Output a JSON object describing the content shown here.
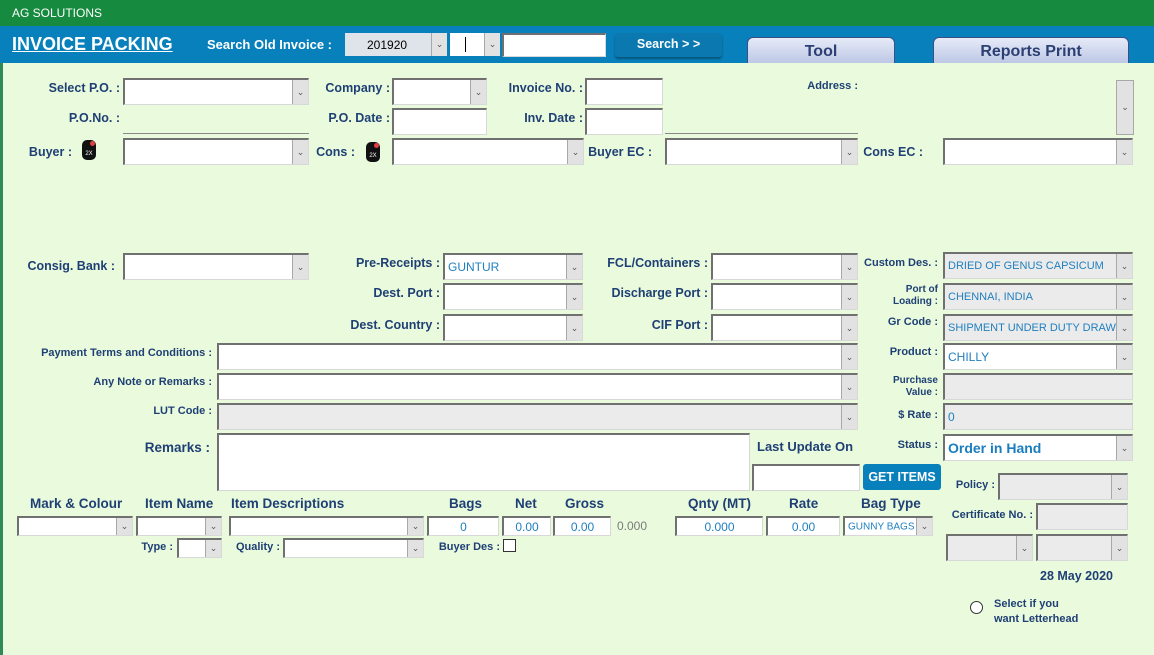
{
  "titlebar": {
    "title": "AG SOLUTIONS"
  },
  "header": {
    "app_title": "INVOICE PACKING",
    "search_label": "Search Old Invoice :",
    "search_year": "201920",
    "search_series": "",
    "search_number": "",
    "search_button": "Search > >",
    "tabs": [
      {
        "label": "Tool"
      },
      {
        "label": "Reports Print"
      }
    ]
  },
  "form": {
    "select_po": {
      "label": "Select P.O. :",
      "value": ""
    },
    "po_no": {
      "label": "P.O.No. :",
      "value": ""
    },
    "buyer": {
      "label": "Buyer :",
      "value": "",
      "icon_text": "2X"
    },
    "company": {
      "label": "Company :",
      "value": ""
    },
    "po_date": {
      "label": "P.O. Date :",
      "value": ""
    },
    "cons": {
      "label": "Cons :",
      "value": "",
      "icon_text": "2X"
    },
    "invoice_no": {
      "label": "Invoice No. :",
      "value": ""
    },
    "inv_date": {
      "label": "Inv. Date :",
      "value": ""
    },
    "buyer_ec": {
      "label": "Buyer EC :",
      "value": ""
    },
    "address": {
      "label": "Address :",
      "value": ""
    },
    "cons_ec": {
      "label": "Cons EC :",
      "value": ""
    },
    "consig_bank": {
      "label": "Consig. Bank :",
      "value": ""
    },
    "pre_receipts": {
      "label": "Pre-Receipts :",
      "value": "GUNTUR"
    },
    "dest_port": {
      "label": "Dest. Port :",
      "value": ""
    },
    "dest_country": {
      "label": "Dest. Country :",
      "value": ""
    },
    "fcl_containers": {
      "label": "FCL/Containers :",
      "value": ""
    },
    "discharge_port": {
      "label": "Discharge Port :",
      "value": ""
    },
    "cif_port": {
      "label": "CIF Port :",
      "value": ""
    },
    "custom_des": {
      "label": "Custom Des. :",
      "value": "DRIED OF GENUS CAPSICUM"
    },
    "port_of_loading": {
      "label_line1": "Port of",
      "label_line2": "Loading :",
      "value": "CHENNAI, INDIA"
    },
    "gr_code": {
      "label": "Gr Code :",
      "value": "SHIPMENT UNDER DUTY DRAW"
    },
    "payment_terms": {
      "label": "Payment Terms and Conditions :",
      "value": ""
    },
    "any_note": {
      "label": "Any Note or Remarks :",
      "value": ""
    },
    "lut_code": {
      "label": "LUT Code :",
      "value": ""
    },
    "remarks": {
      "label": "Remarks :",
      "value": ""
    },
    "product": {
      "label": "Product :",
      "value": "CHILLY"
    },
    "purchase_value": {
      "label_line1": "Purchase",
      "label_line2": "Value :",
      "value": ""
    },
    "dollar_rate": {
      "label": "$ Rate :",
      "value": "0"
    },
    "status": {
      "label": "Status :",
      "value": "Order in Hand"
    },
    "last_update": {
      "label": "Last Update On",
      "value": ""
    },
    "get_items_button": "GET ITEMS",
    "policy": {
      "label": "Policy :",
      "value": ""
    },
    "certificate_no": {
      "label": "Certificate No. :",
      "value": ""
    },
    "extra_select_1": "",
    "extra_select_2": "",
    "date_display": "28 May 2020",
    "letterhead": {
      "label_line1": "Select if you",
      "label_line2": "want Letterhead",
      "checked": false
    }
  },
  "items": {
    "headers": {
      "mark_colour": "Mark & Colour",
      "item_name": "Item Name",
      "item_descriptions": "Item Descriptions",
      "bags": "Bags",
      "net": "Net",
      "gross": "Gross",
      "qnty": "Qnty (MT)",
      "rate": "Rate",
      "bag_type": "Bag Type"
    },
    "row": {
      "mark_colour": "",
      "item_name": "",
      "item_description": "",
      "bags": "0",
      "net": "0.00",
      "gross": "0.00",
      "gross_total": "0.000",
      "qnty": "0.000",
      "rate": "0.00",
      "bag_type": "GUNNY BAGS"
    },
    "type": {
      "label": "Type :",
      "value": ""
    },
    "quality": {
      "label": "Quality :",
      "value": ""
    },
    "buyer_des": {
      "label": "Buyer Des :",
      "checked": false
    }
  }
}
